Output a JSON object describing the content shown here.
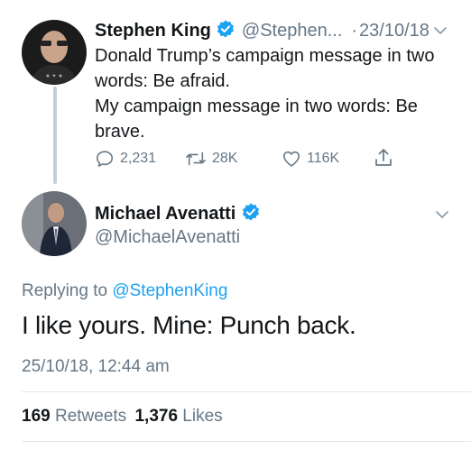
{
  "parent_tweet": {
    "author_name": "Stephen King",
    "author_handle": "@Stephen...",
    "separator": "·",
    "date": "23/10/18",
    "text": "Donald Trump’s campaign message in two words: Be afraid.\nMy campaign message in two words: Be brave.",
    "replies_count": "2,231",
    "retweets_count": "28K",
    "likes_count": "116K"
  },
  "reply_tweet": {
    "author_name": "Michael Avenatti",
    "author_handle": "@MichaelAvenatti",
    "replying_to_prefix": "Replying to",
    "replying_to_handle": "@StephenKing",
    "text": "I like yours. Mine: Punch back.",
    "timestamp": "25/10/18, 12:44 am",
    "retweets_count": "169",
    "retweets_label": "Retweets",
    "likes_count": "1,376",
    "likes_label": "Likes"
  },
  "colors": {
    "accent": "#1da1f2",
    "text": "#14171a",
    "secondary": "#657786",
    "divider": "#e1e8ed"
  }
}
